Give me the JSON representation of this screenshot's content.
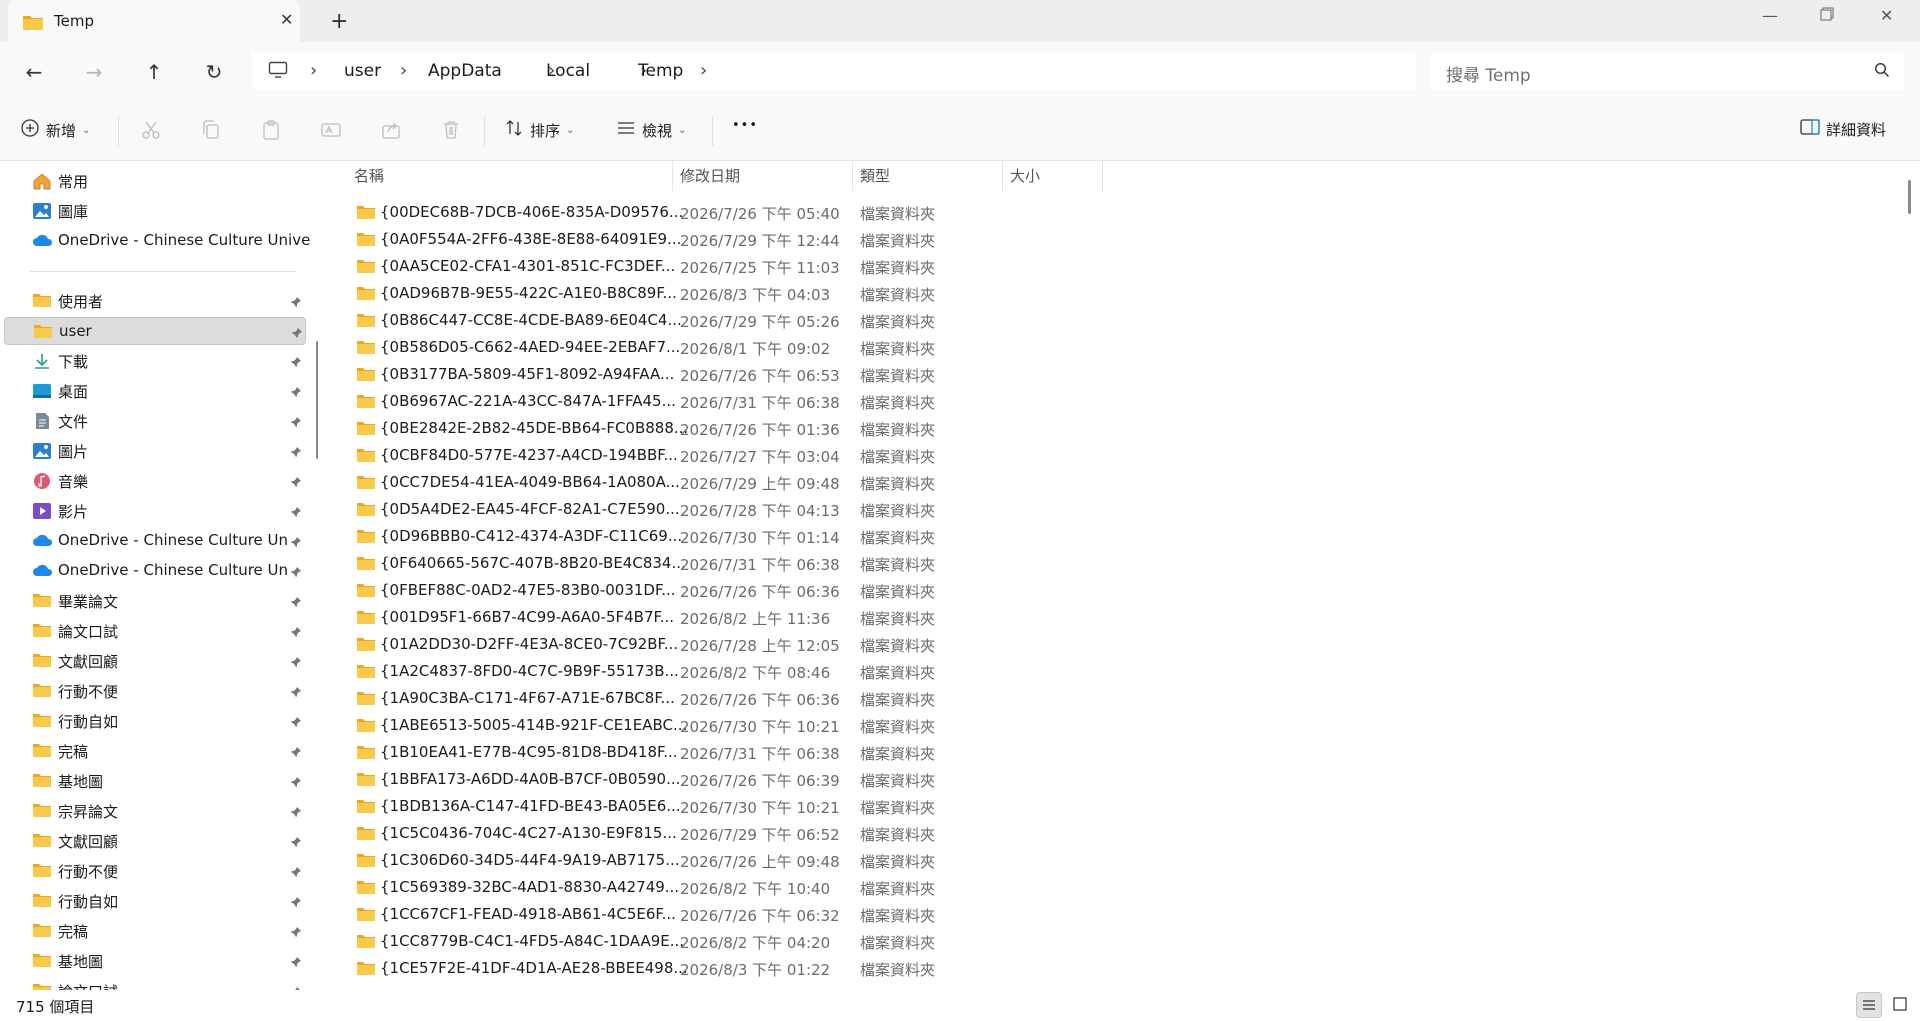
{
  "tab": {
    "title": "Temp"
  },
  "breadcrumb": [
    "user",
    "AppData",
    "Local",
    "Temp"
  ],
  "search": {
    "placeholder": "搜尋 Temp"
  },
  "toolbar": {
    "new_label": "新增",
    "sort_label": "排序",
    "view_label": "檢視",
    "more_label": "•••",
    "details_label": "詳細資料"
  },
  "sidebar": {
    "top_items": [
      {
        "label": "常用",
        "icon": "home-icon"
      },
      {
        "label": "圖庫",
        "icon": "gallery-icon"
      },
      {
        "label": "OneDrive - Chinese Culture University",
        "icon": "onedrive-icon"
      }
    ],
    "items": [
      {
        "label": "使用者",
        "icon": "folder-icon",
        "pinned": true
      },
      {
        "label": "user",
        "icon": "folder-icon",
        "pinned": true,
        "selected": true
      },
      {
        "label": "下載",
        "icon": "download-icon",
        "pinned": true
      },
      {
        "label": "桌面",
        "icon": "desktop-icon",
        "pinned": true
      },
      {
        "label": "文件",
        "icon": "document-icon",
        "pinned": true
      },
      {
        "label": "圖片",
        "icon": "pictures-icon",
        "pinned": true
      },
      {
        "label": "音樂",
        "icon": "music-icon",
        "pinned": true
      },
      {
        "label": "影片",
        "icon": "video-icon",
        "pinned": true
      },
      {
        "label": "OneDrive - Chinese Culture University",
        "icon": "onedrive-icon",
        "pinned": true
      },
      {
        "label": "OneDrive - Chinese Culture University",
        "icon": "onedrive-icon",
        "pinned": true
      },
      {
        "label": "畢業論文",
        "icon": "folder-icon",
        "pinned": true
      },
      {
        "label": "論文口試",
        "icon": "folder-icon",
        "pinned": true
      },
      {
        "label": "文獻回顧",
        "icon": "folder-icon",
        "pinned": true
      },
      {
        "label": "行動不便",
        "icon": "folder-icon",
        "pinned": true
      },
      {
        "label": "行動自如",
        "icon": "folder-icon",
        "pinned": true
      },
      {
        "label": "完稿",
        "icon": "folder-icon",
        "pinned": true
      },
      {
        "label": "基地圖",
        "icon": "folder-icon",
        "pinned": true
      },
      {
        "label": "宗昇論文",
        "icon": "folder-icon",
        "pinned": true
      },
      {
        "label": "文獻回顧",
        "icon": "folder-icon",
        "pinned": true
      },
      {
        "label": "行動不便",
        "icon": "folder-icon",
        "pinned": true
      },
      {
        "label": "行動自如",
        "icon": "folder-icon",
        "pinned": true
      },
      {
        "label": "完稿",
        "icon": "folder-icon",
        "pinned": true
      },
      {
        "label": "基地圖",
        "icon": "folder-icon",
        "pinned": true
      },
      {
        "label": "論文口試",
        "icon": "folder-icon",
        "pinned": true
      }
    ]
  },
  "columns": {
    "name": "名稱",
    "date": "修改日期",
    "type": "類型",
    "size": "大小"
  },
  "files": [
    {
      "name": "{00DEC68B-7DCB-406E-835A-D09576...",
      "date": "2026/7/26 下午 05:40",
      "type": "檔案資料夾"
    },
    {
      "name": "{0A0F554A-2FF6-438E-8E88-64091E9...",
      "date": "2026/7/29 下午 12:44",
      "type": "檔案資料夾"
    },
    {
      "name": "{0AA5CE02-CFA1-4301-851C-FC3DEF...",
      "date": "2026/7/25 下午 11:03",
      "type": "檔案資料夾"
    },
    {
      "name": "{0AD96B7B-9E55-422C-A1E0-B8C89F...",
      "date": "2026/8/3 下午 04:03",
      "type": "檔案資料夾"
    },
    {
      "name": "{0B86C447-CC8E-4CDE-BA89-6E04C4...",
      "date": "2026/7/29 下午 05:26",
      "type": "檔案資料夾"
    },
    {
      "name": "{0B586D05-C662-4AED-94EE-2EBAF7...",
      "date": "2026/8/1 下午 09:02",
      "type": "檔案資料夾"
    },
    {
      "name": "{0B3177BA-5809-45F1-8092-A94FAA...",
      "date": "2026/7/26 下午 06:53",
      "type": "檔案資料夾"
    },
    {
      "name": "{0B6967AC-221A-43CC-847A-1FFA45...",
      "date": "2026/7/31 下午 06:38",
      "type": "檔案資料夾"
    },
    {
      "name": "{0BE2842E-2B82-45DE-BB64-FC0B888...",
      "date": "2026/7/26 下午 01:36",
      "type": "檔案資料夾"
    },
    {
      "name": "{0CBF84D0-577E-4237-A4CD-194BBF...",
      "date": "2026/7/27 下午 03:04",
      "type": "檔案資料夾"
    },
    {
      "name": "{0CC7DE54-41EA-4049-BB64-1A080A...",
      "date": "2026/7/29 上午 09:48",
      "type": "檔案資料夾"
    },
    {
      "name": "{0D5A4DE2-EA45-4FCF-82A1-C7E590...",
      "date": "2026/7/28 下午 04:13",
      "type": "檔案資料夾"
    },
    {
      "name": "{0D96BBB0-C412-4374-A3DF-C11C69...",
      "date": "2026/7/30 下午 01:14",
      "type": "檔案資料夾"
    },
    {
      "name": "{0F640665-567C-407B-8B20-BE4C834...",
      "date": "2026/7/31 下午 06:38",
      "type": "檔案資料夾"
    },
    {
      "name": "{0FBEF88C-0AD2-47E5-83B0-0031DF...",
      "date": "2026/7/26 下午 06:36",
      "type": "檔案資料夾"
    },
    {
      "name": "{001D95F1-66B7-4C99-A6A0-5F4B7F...",
      "date": "2026/8/2 上午 11:36",
      "type": "檔案資料夾"
    },
    {
      "name": "{01A2DD30-D2FF-4E3A-8CE0-7C92BF...",
      "date": "2026/7/28 上午 12:05",
      "type": "檔案資料夾"
    },
    {
      "name": "{1A2C4837-8FD0-4C7C-9B9F-55173B...",
      "date": "2026/8/2 下午 08:46",
      "type": "檔案資料夾"
    },
    {
      "name": "{1A90C3BA-C171-4F67-A71E-67BC8F...",
      "date": "2026/7/26 下午 06:36",
      "type": "檔案資料夾"
    },
    {
      "name": "{1ABE6513-5005-414B-921F-CE1EABC...",
      "date": "2026/7/30 下午 10:21",
      "type": "檔案資料夾"
    },
    {
      "name": "{1B10EA41-E77B-4C95-81D8-BD418F...",
      "date": "2026/7/31 下午 06:38",
      "type": "檔案資料夾"
    },
    {
      "name": "{1BBFA173-A6DD-4A0B-B7CF-0B0590...",
      "date": "2026/7/26 下午 06:39",
      "type": "檔案資料夾"
    },
    {
      "name": "{1BDB136A-C147-41FD-BE43-BA05E6...",
      "date": "2026/7/30 下午 10:21",
      "type": "檔案資料夾"
    },
    {
      "name": "{1C5C0436-704C-4C27-A130-E9F815...",
      "date": "2026/7/29 下午 06:52",
      "type": "檔案資料夾"
    },
    {
      "name": "{1C306D60-34D5-44F4-9A19-AB7175...",
      "date": "2026/7/26 上午 09:48",
      "type": "檔案資料夾"
    },
    {
      "name": "{1C569389-32BC-4AD1-8830-A42749...",
      "date": "2026/8/2 下午 10:40",
      "type": "檔案資料夾"
    },
    {
      "name": "{1CC67CF1-FEAD-4918-AB61-4C5E6F...",
      "date": "2026/7/26 下午 06:32",
      "type": "檔案資料夾"
    },
    {
      "name": "{1CC8779B-C4C1-4FD5-A84C-1DAA9E...",
      "date": "2026/8/2 下午 04:20",
      "type": "檔案資料夾"
    },
    {
      "name": "{1CE57F2E-41DF-4D1A-AE28-BBEE498...",
      "date": "2026/8/3 下午 01:22",
      "type": "檔案資料夾"
    }
  ],
  "status": {
    "item_count": "715 個項目"
  },
  "colors": {
    "folder": "#F8C94A",
    "folder_dark": "#E9A825",
    "selected_bg": "#DCDCDC",
    "onedrive": "#1E88E5"
  }
}
